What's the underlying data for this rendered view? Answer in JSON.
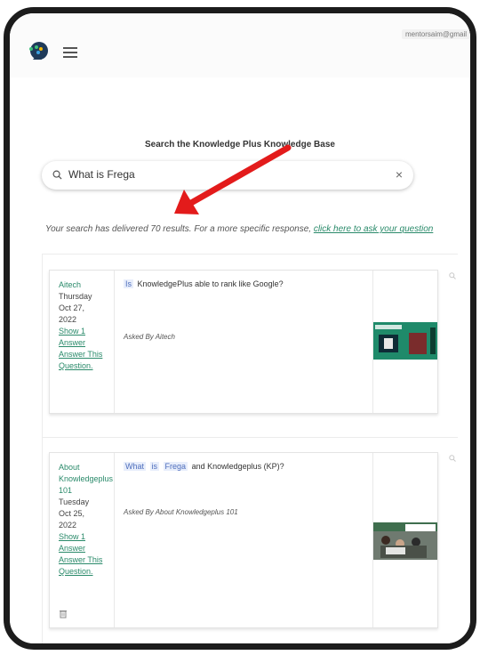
{
  "header": {
    "user_email": "mentorsaim@gmail",
    "logo_icon": "brain-head-icon",
    "menu_icon": "hamburger-icon"
  },
  "search": {
    "heading": "Search the Knowledge Plus Knowledge Base",
    "value": "What is Frega",
    "clear_icon": "close-icon"
  },
  "results": {
    "prefix": "Your search has delivered 70 results. For a more specific response, ",
    "link": "click here to ask your question"
  },
  "cards": [
    {
      "author": "Aitech",
      "weekday": "Thursday",
      "date": "Oct 27,",
      "year": "2022",
      "show_answers": "Show 1 Answer",
      "answer_link": "Answer This Question.",
      "highlight_words": [
        "Is"
      ],
      "question_rest": "KnowledgePlus able to rank like Google?",
      "asked_by": "Asked By Aitech"
    },
    {
      "author": "About Knowledgeplus 101",
      "weekday": "Tuesday",
      "date": "Oct 25,",
      "year": "2022",
      "show_answers": "Show 1 Answer",
      "answer_link": "Answer This Question.",
      "highlight_words": [
        "What",
        "is",
        "Frega"
      ],
      "question_rest": "and Knowledgeplus (KP)?",
      "asked_by": "Asked By About Knowledgeplus 101"
    }
  ],
  "annotation": {
    "color": "#e31b1b"
  }
}
